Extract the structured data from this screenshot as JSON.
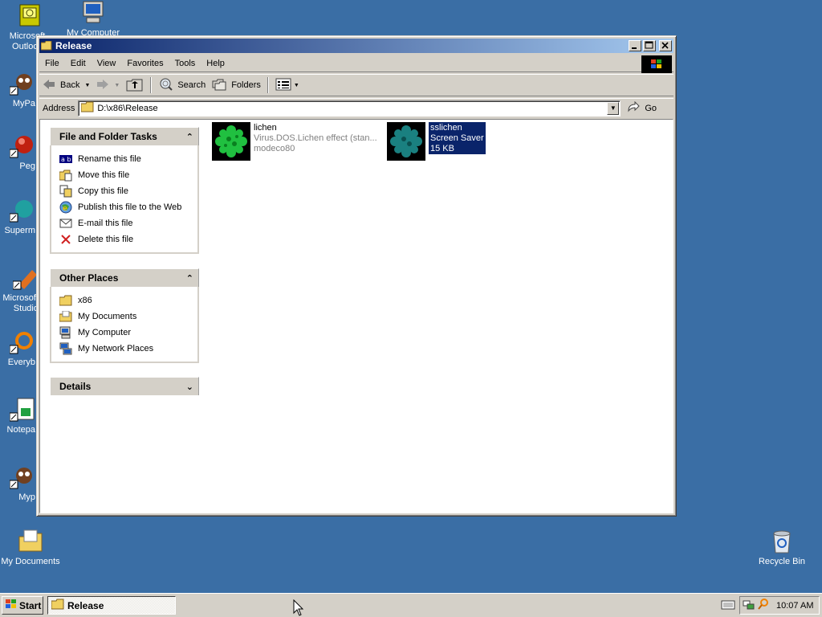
{
  "desktop": {
    "icons": [
      {
        "label": "Microsoft Outlook",
        "icon": "outlook-icon"
      },
      {
        "label": "My Computer",
        "icon": "computer-icon"
      },
      {
        "label": "MyPa",
        "icon": "mypa-icon"
      },
      {
        "label": "Peg",
        "icon": "peg-icon"
      },
      {
        "label": "Superm",
        "icon": "superm-icon"
      },
      {
        "label": "Microsoft Studio",
        "icon": "studio-icon"
      },
      {
        "label": "Everyb",
        "icon": "everyb-icon"
      },
      {
        "label": "Notepa",
        "icon": "notepad-icon"
      },
      {
        "label": "Myp",
        "icon": "myp-icon"
      },
      {
        "label": "My Documents",
        "icon": "my-documents-icon"
      },
      {
        "label": "Recycle Bin",
        "icon": "recycle-bin-icon"
      }
    ]
  },
  "window": {
    "title": "Release",
    "menu": [
      "File",
      "Edit",
      "View",
      "Favorites",
      "Tools",
      "Help"
    ],
    "toolbar": {
      "back": "Back",
      "search": "Search",
      "folders": "Folders"
    },
    "address": {
      "label": "Address",
      "value": "D:\\x86\\Release",
      "go": "Go"
    }
  },
  "tasks": {
    "title": "File and Folder Tasks",
    "items": [
      {
        "label": "Rename this file",
        "icon": "rename-icon"
      },
      {
        "label": "Move this file",
        "icon": "move-icon"
      },
      {
        "label": "Copy this file",
        "icon": "copy-icon"
      },
      {
        "label": "Publish this file to the Web",
        "icon": "publish-web-icon"
      },
      {
        "label": "E-mail this file",
        "icon": "email-icon"
      },
      {
        "label": "Delete this file",
        "icon": "delete-icon"
      }
    ]
  },
  "other_places": {
    "title": "Other Places",
    "items": [
      {
        "label": "x86",
        "icon": "folder-icon"
      },
      {
        "label": "My Documents",
        "icon": "my-documents-icon"
      },
      {
        "label": "My Computer",
        "icon": "computer-icon"
      },
      {
        "label": "My Network Places",
        "icon": "network-icon"
      }
    ]
  },
  "details": {
    "title": "Details"
  },
  "files": [
    {
      "name": "lichen",
      "line2": "Virus.DOS.Lichen effect (stan...",
      "line3": "modeco80",
      "selected": false
    },
    {
      "name": "sslichen",
      "line2": "Screen Saver",
      "line3": "15 KB",
      "selected": true
    }
  ],
  "taskbar": {
    "start": "Start",
    "task": "Release",
    "clock": "10:07 AM"
  },
  "colors": {
    "desktop": "#3a6ea5",
    "title_active_start": "#0a246a",
    "title_active_end": "#a6caf0",
    "selection": "#0a246a",
    "face": "#d4d0c8"
  }
}
